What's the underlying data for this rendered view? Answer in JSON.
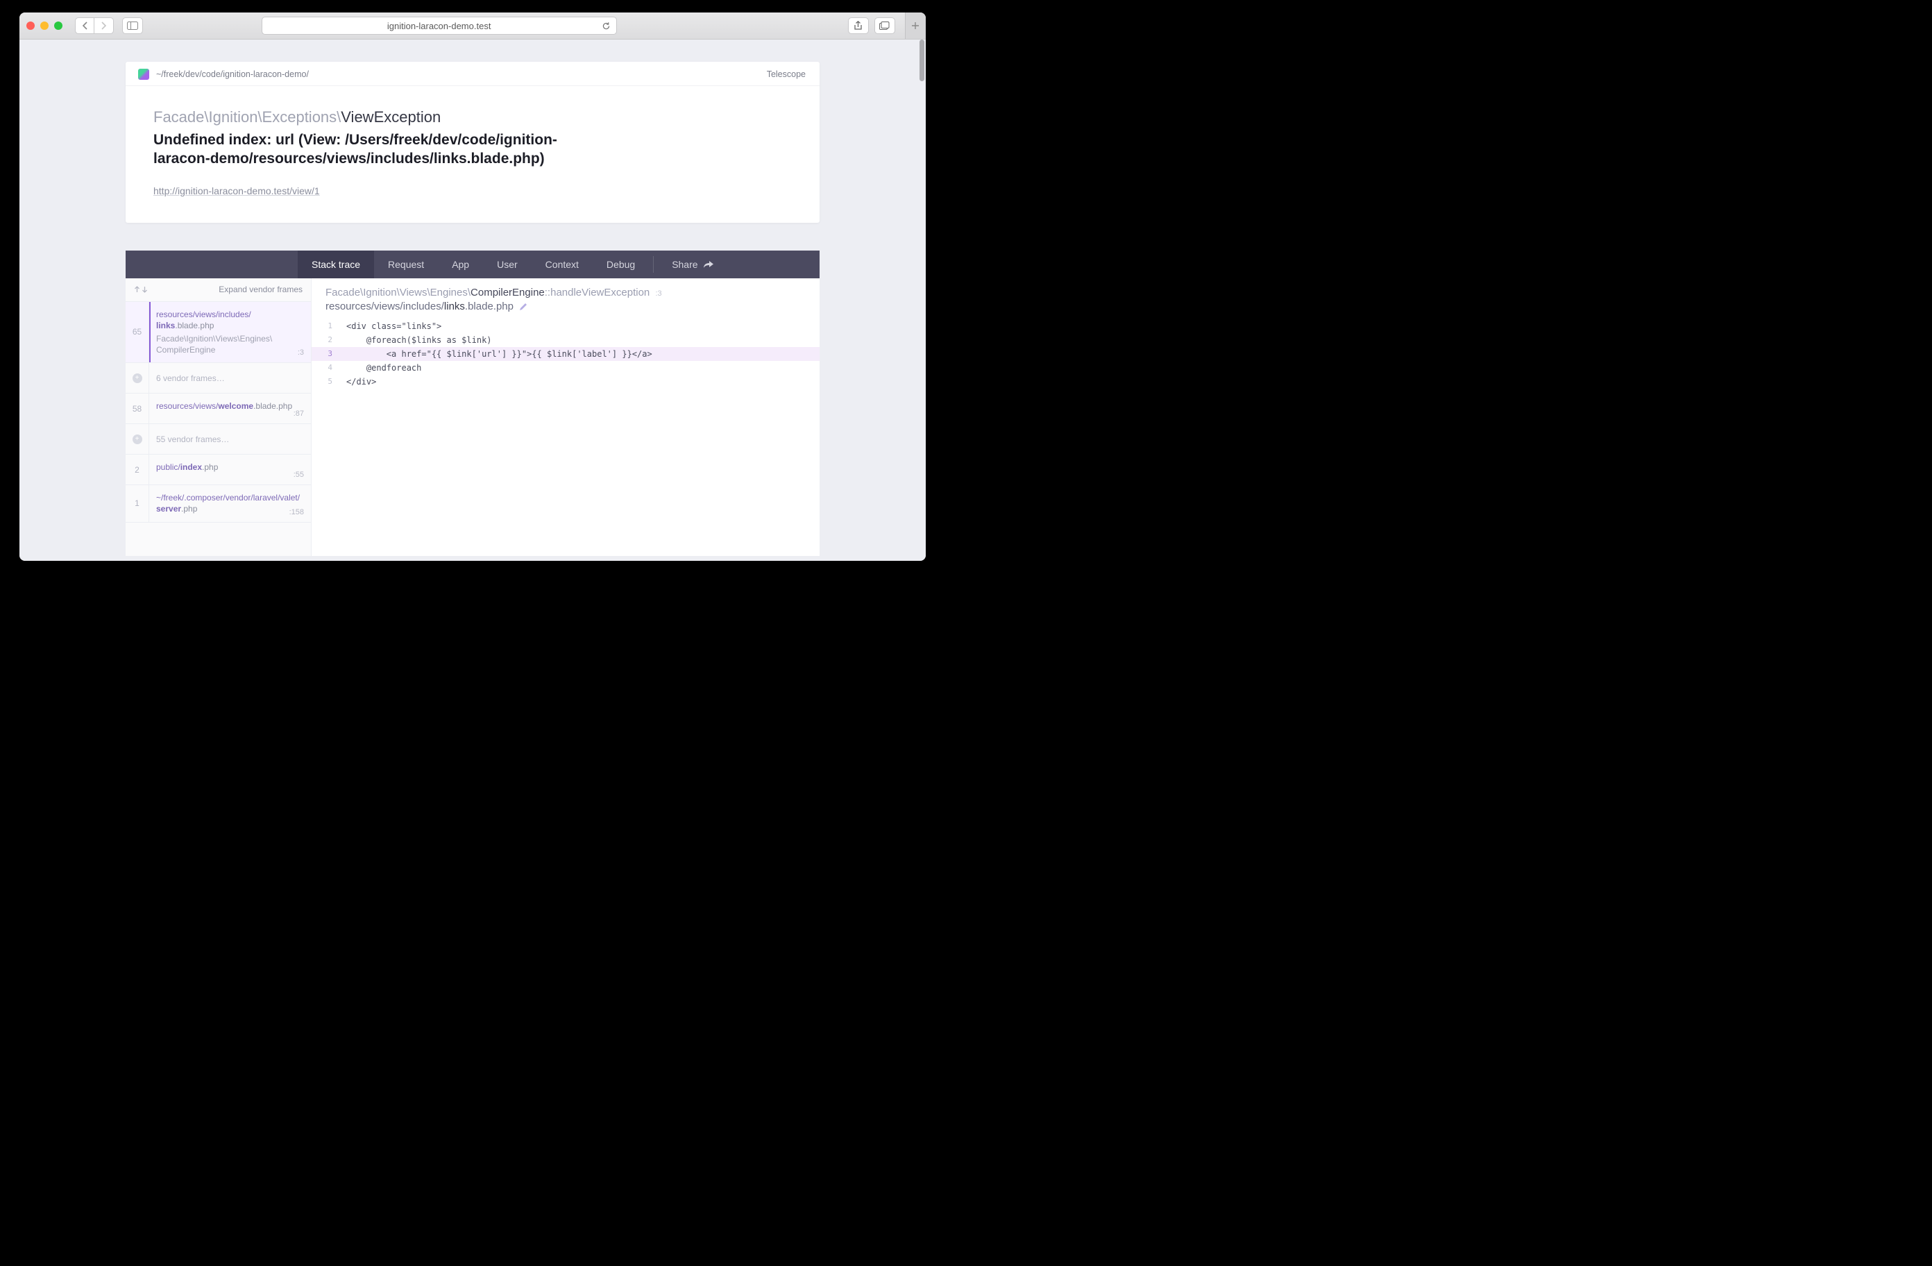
{
  "browser": {
    "address": "ignition-laracon-demo.test"
  },
  "header": {
    "repo_path": "~/freek/dev/code/ignition-laracon-demo/",
    "telescope": "Telescope",
    "namespace_prefix": "Facade\\Ignition\\Exceptions\\",
    "exception_class": "ViewException",
    "message": "Undefined index: url (View: /Users/freek/dev/code/ignition-laracon-demo/resources/views/includes/links.blade.php)",
    "url": "http://ignition-laracon-demo.test/view/1"
  },
  "tabs": {
    "stack": "Stack trace",
    "request": "Request",
    "app": "App",
    "user": "User",
    "context": "Context",
    "debug": "Debug",
    "share": "Share"
  },
  "frames_toolbar": {
    "expand": "Expand vendor frames"
  },
  "frames": {
    "active": {
      "num": "65",
      "path_pre": "resources/views/includes/",
      "path_bold": "links",
      "path_ext": ".blade.php",
      "sub": "Facade\\Ignition\\Views\\Engines\\\nCompilerEngine",
      "line": ":3"
    },
    "collapsed1": "6 vendor frames…",
    "f58": {
      "num": "58",
      "pre": "resources/views/",
      "bold": "welcome",
      "ext": ".blade.php",
      "line": ":87"
    },
    "collapsed2": "55 vendor frames…",
    "f2": {
      "num": "2",
      "pre": "public/",
      "bold": "index",
      "ext": ".php",
      "line": ":55"
    },
    "f1": {
      "num": "1",
      "pre": "~/freek/.composer/vendor/laravel/valet/",
      "bold": "server",
      "ext": ".php",
      "line": ":158"
    }
  },
  "code": {
    "ns_pre": "Facade\\Ignition\\Views\\Engines\\",
    "ns_class": "CompilerEngine",
    "method": "::handleViewException",
    "lineref": ":3",
    "file_pre": "resources/views/includes/",
    "file_bold": "links",
    "file_ext": ".blade.php",
    "lines": [
      {
        "n": "1",
        "t": "<div class=\"links\">"
      },
      {
        "n": "2",
        "t": "    @foreach($links as $link)"
      },
      {
        "n": "3",
        "t": "        <a href=\"{{ $link['url'] }}\">{{ $link['label'] }}</a>",
        "hl": true
      },
      {
        "n": "4",
        "t": "    @endforeach"
      },
      {
        "n": "5",
        "t": "</div>"
      }
    ]
  }
}
